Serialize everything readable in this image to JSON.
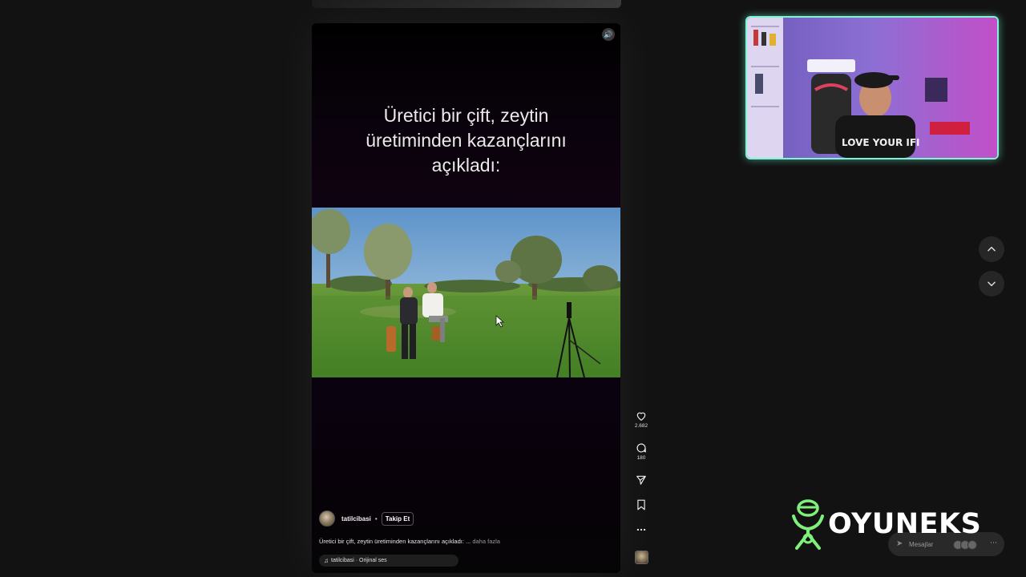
{
  "reel": {
    "caption": "Üretici bir çift, zeytin\nüretiminden kazançlarını\naçıkladı:",
    "sound_icon": "speaker-icon",
    "author": "tatilcibasi",
    "separator": "•",
    "follow_label": "Takip Et",
    "description": "Üretici bir çift, zeytin üretiminden kazançlarını açıkladı: ...",
    "more_label": "daha fazla",
    "audio": "tatilcibasi · Orijinal ses"
  },
  "actions": {
    "like_icon": "heart-icon",
    "likes": "2.682",
    "comment_icon": "comment-icon",
    "comments": "180",
    "share_icon": "send-icon",
    "save_icon": "bookmark-icon",
    "more_icon": "more-horizontal-icon"
  },
  "navigation": {
    "up_icon": "chevron-up-icon",
    "down_icon": "chevron-down-icon"
  },
  "overlay": {
    "brand": "OYUNEKS",
    "webcam_shirt_text": "LOVE YOUR IFI",
    "messages_label": "Mesajlar",
    "accent_color": "#7ff5d7"
  }
}
